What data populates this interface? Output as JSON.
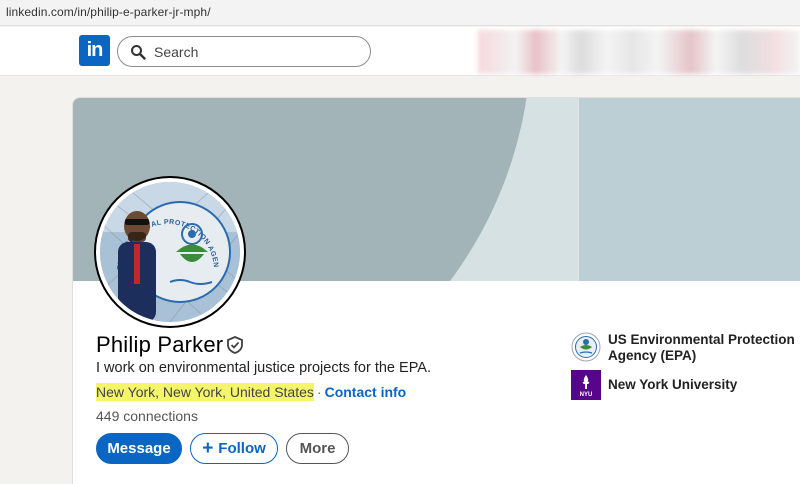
{
  "browser": {
    "url": "linkedin.com/in/philip-e-parker-jr-mph/"
  },
  "nav": {
    "logo_text": "in",
    "search": {
      "placeholder": "Search",
      "icon": "search-icon"
    },
    "brand_color": "#0a66c2"
  },
  "profile": {
    "name": "Philip Parker",
    "verified_icon": "verified-shield-icon",
    "headline": "I work on environmental justice projects for the EPA.",
    "location": "New York, New York, United States",
    "separator": "·",
    "contact_info": "Contact info",
    "connections": "449 connections",
    "avatar_seal_text": "UNITED STATES ENVIRONMENTAL PROTECTION AGENCY"
  },
  "actions": {
    "message": "Message",
    "follow": "Follow",
    "follow_icon": "+",
    "more": "More"
  },
  "organizations": [
    {
      "name": "US Environmental Protection Agency (EPA)",
      "logo": "epa-logo"
    },
    {
      "name": "New York University",
      "logo": "nyu-logo",
      "logo_text": "NYU",
      "color": "#57068c"
    }
  ],
  "highlight_color": "#f5f56c"
}
